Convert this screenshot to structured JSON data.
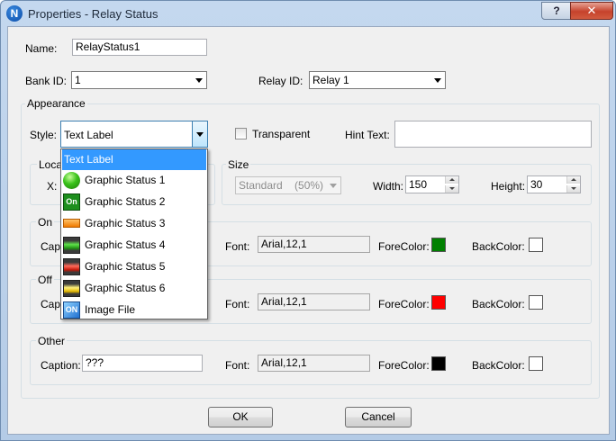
{
  "window": {
    "title": "Properties - Relay Status",
    "app_icon_letter": "N",
    "help_glyph": "?",
    "close_glyph": "✕"
  },
  "fields": {
    "name_label": "Name:",
    "name_value": "RelayStatus1",
    "bank_label": "Bank ID:",
    "bank_value": "1",
    "relay_label": "Relay ID:",
    "relay_value": "Relay 1"
  },
  "appearance": {
    "group_title": "Appearance",
    "style_label": "Style:",
    "style_value": "Text Label",
    "transparent_label": "Transparent",
    "transparent_checked": false,
    "hint_label": "Hint Text:",
    "hint_value": ""
  },
  "location": {
    "group_title": "Loca",
    "x_label": "X:"
  },
  "size": {
    "group_title": "Size",
    "preset_value": "Standard    (50%)",
    "width_label": "Width:",
    "width_value": "150",
    "height_label": "Height:",
    "height_value": "30"
  },
  "on_group": {
    "group_title": "On",
    "caption_label": "Captio",
    "font_label": "Font:",
    "font_value": "Arial,12,1",
    "forecolor_label": "ForeColor:",
    "forecolor": "#008000",
    "backcolor_label": "BackColor:",
    "backcolor": "#ffffff"
  },
  "off_group": {
    "group_title": "Off",
    "caption_label": "Capti",
    "font_label": "Font:",
    "font_value": "Arial,12,1",
    "forecolor_label": "ForeColor:",
    "forecolor": "#ff0000",
    "backcolor_label": "BackColor:",
    "backcolor": "#ffffff"
  },
  "other_group": {
    "group_title": "Other",
    "caption_label": "Caption:",
    "caption_value": "???",
    "font_label": "Font:",
    "font_value": "Arial,12,1",
    "forecolor_label": "ForeColor:",
    "forecolor": "#000000",
    "backcolor_label": "BackColor:",
    "backcolor": "#ffffff"
  },
  "style_options": [
    {
      "label": "Text Label",
      "icon": "none",
      "selected": true
    },
    {
      "label": "Graphic Status 1",
      "icon": "green-led-icon"
    },
    {
      "label": "Graphic Status 2",
      "icon": "on-badge-icon",
      "icon_text": "On"
    },
    {
      "label": "Graphic Status 3",
      "icon": "orange-bar-icon"
    },
    {
      "label": "Graphic Status 4",
      "icon": "green-bar-icon"
    },
    {
      "label": "Graphic Status 5",
      "icon": "red-bar-icon"
    },
    {
      "label": "Graphic Status 6",
      "icon": "yellow-bar-icon"
    },
    {
      "label": "Image File",
      "icon": "on-image-icon",
      "icon_text": "ON"
    }
  ],
  "buttons": {
    "ok": "OK",
    "cancel": "Cancel"
  }
}
